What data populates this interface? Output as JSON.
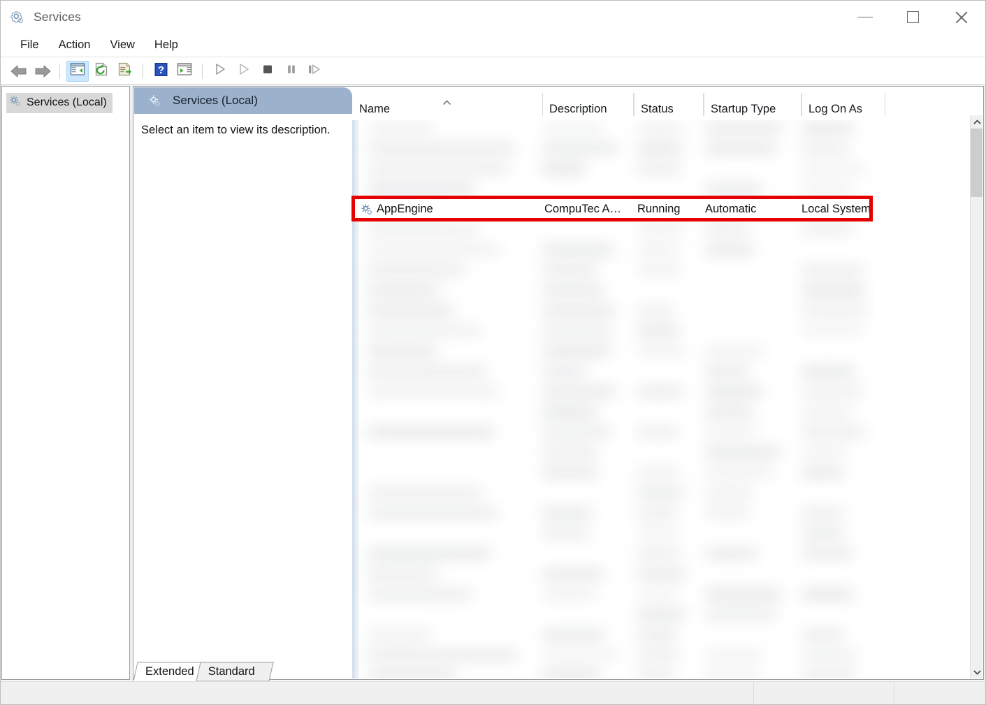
{
  "window": {
    "title": "Services",
    "icon": "services-gear-icon",
    "controls": {
      "minimize": "Minimize",
      "maximize": "Maximize",
      "close": "Close"
    }
  },
  "menubar": {
    "items": [
      {
        "label": "File",
        "name": "menu-file"
      },
      {
        "label": "Action",
        "name": "menu-action"
      },
      {
        "label": "View",
        "name": "menu-view"
      },
      {
        "label": "Help",
        "name": "menu-help"
      }
    ]
  },
  "toolbar": {
    "buttons": [
      {
        "icon": "back-arrow-icon",
        "tooltip": "Back"
      },
      {
        "icon": "forward-arrow-icon",
        "tooltip": "Forward"
      },
      {
        "icon": "show-hide-console-tree-icon",
        "tooltip": "Show/Hide Console Tree",
        "active": true
      },
      {
        "icon": "refresh-icon",
        "tooltip": "Refresh"
      },
      {
        "icon": "export-list-icon",
        "tooltip": "Export List"
      },
      {
        "icon": "help-icon",
        "tooltip": "Help"
      },
      {
        "icon": "show-hide-action-pane-icon",
        "tooltip": "Show/Hide Action Pane"
      },
      {
        "icon": "start-service-icon",
        "tooltip": "Start Service"
      },
      {
        "icon": "resume-service-icon",
        "tooltip": "Resume Service"
      },
      {
        "icon": "stop-service-icon",
        "tooltip": "Stop Service"
      },
      {
        "icon": "pause-service-icon",
        "tooltip": "Pause Service"
      },
      {
        "icon": "restart-service-icon",
        "tooltip": "Restart Service"
      }
    ]
  },
  "tree": {
    "root_label": "Services (Local)",
    "root_icon": "services-gear-icon"
  },
  "content": {
    "header_title": "Services (Local)",
    "header_icon": "services-gear-icon",
    "header_color": "#9bb1cc",
    "description": "Select an item to view its description."
  },
  "list": {
    "columns": [
      {
        "label": "Name",
        "name": "column-name",
        "sorted": "asc"
      },
      {
        "label": "Description",
        "name": "column-description"
      },
      {
        "label": "Status",
        "name": "column-status"
      },
      {
        "label": "Startup Type",
        "name": "column-startup-type"
      },
      {
        "label": "Log On As",
        "name": "column-log-on-as"
      }
    ],
    "highlight_color": "#e60000",
    "selected_row": {
      "icon": "service-gear-icon",
      "name": "AppEngine",
      "description": "CompuTec A…",
      "status": "Running",
      "startup_type": "Automatic",
      "log_on_as": "Local System"
    }
  },
  "scrollbar": {
    "up_arrow": "chevron-up-icon",
    "down_arrow": "chevron-down-icon"
  },
  "tabs": [
    {
      "label": "Extended",
      "name": "tab-extended",
      "active": true
    },
    {
      "label": "Standard",
      "name": "tab-standard",
      "active": false
    }
  ],
  "statusbar": {
    "cells": [
      "",
      "",
      ""
    ]
  }
}
